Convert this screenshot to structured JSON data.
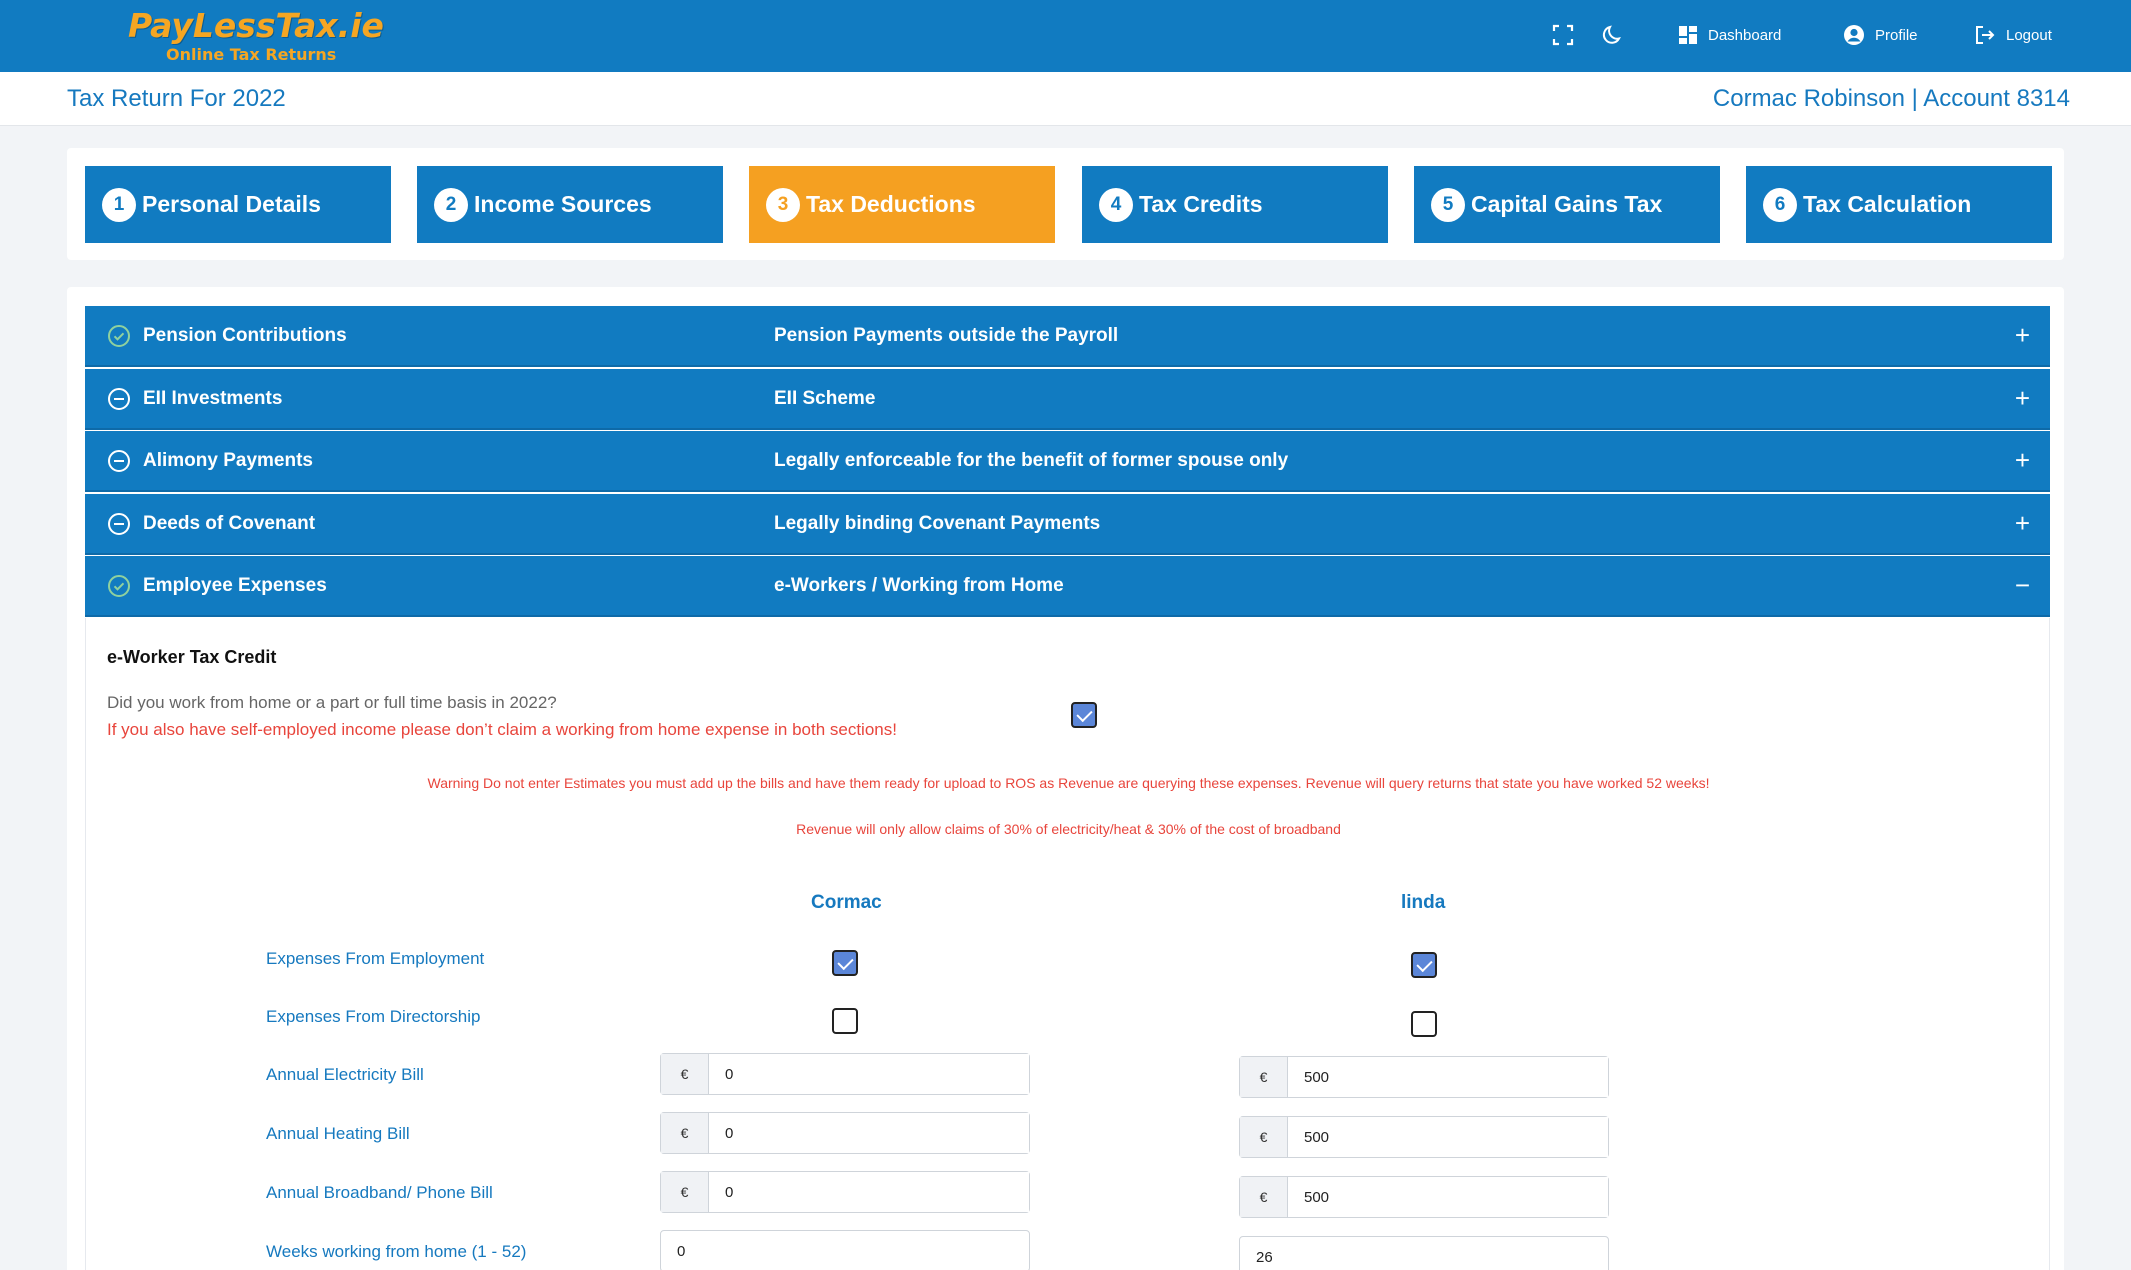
{
  "brand": {
    "name": "PayLessTax.ie",
    "tagline": "Online Tax Returns",
    "accent": "#f5a623",
    "primary": "#117bc1"
  },
  "nav": {
    "fullscreen_icon": "fullscreen-icon",
    "dark_mode_icon": "moon-icon",
    "dashboard_label": "Dashboard",
    "profile_label": "Profile",
    "logout_label": "Logout"
  },
  "header": {
    "title": "Tax Return For 2022",
    "account": "Cormac Robinson | Account 8314"
  },
  "steps": [
    {
      "num": "1",
      "label": "Personal Details"
    },
    {
      "num": "2",
      "label": "Income Sources"
    },
    {
      "num": "3",
      "label": "Tax Deductions",
      "active": true
    },
    {
      "num": "4",
      "label": "Tax Credits"
    },
    {
      "num": "5",
      "label": "Capital Gains Tax"
    },
    {
      "num": "6",
      "label": "Tax Calculation"
    }
  ],
  "accordion": [
    {
      "label": "Pension Contributions",
      "desc": "Pension Payments outside the Payroll",
      "status": "check-circle-icon",
      "toggle": "+"
    },
    {
      "label": "EII Investments",
      "desc": "EII Scheme",
      "status": "minus-circle-icon",
      "toggle": "+"
    },
    {
      "label": "Alimony Payments",
      "desc": "Legally enforceable for the benefit of former spouse only",
      "status": "minus-circle-icon",
      "toggle": "+"
    },
    {
      "label": "Deeds of Covenant",
      "desc": "Legally binding Covenant Payments",
      "status": "minus-circle-icon",
      "toggle": "+"
    },
    {
      "label": "Employee Expenses",
      "desc": "e-Workers / Working from Home",
      "status": "check-circle-icon",
      "toggle": "−"
    }
  ],
  "eworker": {
    "title": "e-Worker Tax Credit",
    "question": "Did you work from home or a part or full time basis in 2022?",
    "question_checked": true,
    "self_employed_warning": "If you also have self-employed income please don’t claim a working from home expense in both sections!",
    "estimates_warning": "Warning Do not enter Estimates you must add up the bills and have them ready for upload to ROS as Revenue are querying these expenses. Revenue will query returns that state you have worked 52 weeks!",
    "revenue_note": "Revenue will only allow claims of 30% of electricity/heat & 30% of the cost of broadband",
    "currency": "€",
    "persons": [
      "Cormac",
      "linda"
    ],
    "labels": {
      "employment": "Expenses From Employment",
      "directorship": "Expenses From Directorship",
      "electricity": "Annual Electricity Bill",
      "heating": "Annual Heating Bill",
      "broadband": "Annual Broadband/ Phone Bill",
      "weeks": "Weeks working from home (1 - 52)"
    },
    "values": {
      "cormac": {
        "employment": true,
        "directorship": false,
        "electricity": "0",
        "heating": "0",
        "broadband": "0",
        "weeks": "0"
      },
      "linda": {
        "employment": true,
        "directorship": false,
        "electricity": "500",
        "heating": "500",
        "broadband": "500",
        "weeks": "26"
      }
    }
  }
}
